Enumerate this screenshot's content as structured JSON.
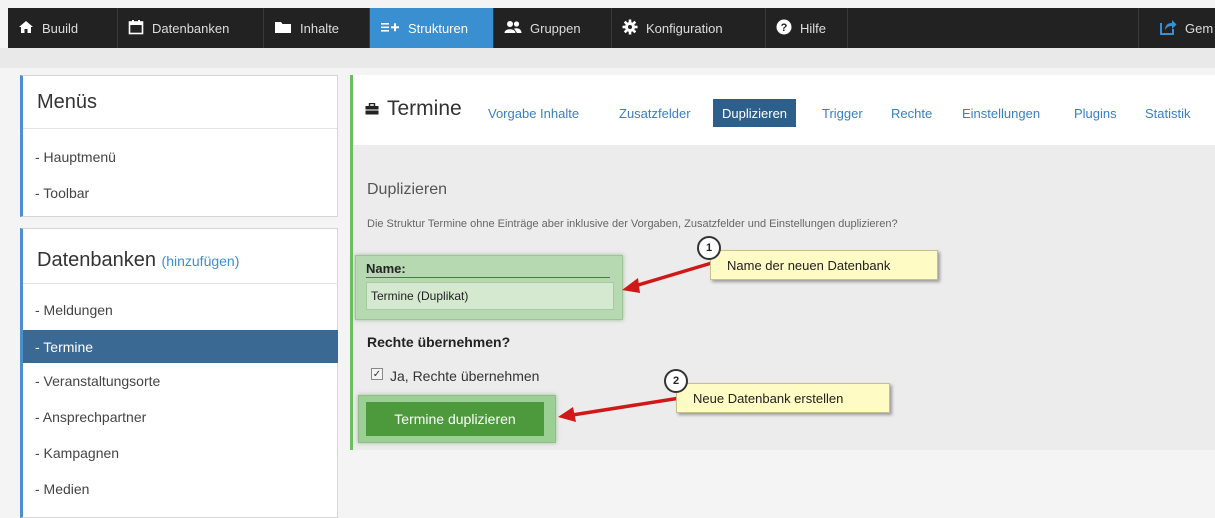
{
  "nav": {
    "items": [
      {
        "label": "Buuild",
        "icon": "home-icon"
      },
      {
        "label": "Datenbanken",
        "icon": "calendar-icon"
      },
      {
        "label": "Inhalte",
        "icon": "folder-icon"
      },
      {
        "label": "Strukturen",
        "icon": "structure-icon",
        "active": true
      },
      {
        "label": "Gruppen",
        "icon": "users-icon"
      },
      {
        "label": "Konfiguration",
        "icon": "gear-icon"
      },
      {
        "label": "Hilfe",
        "icon": "help-icon"
      }
    ],
    "right_label": "Gem",
    "right_icon": "share-icon",
    "active_color": "#3a8fd0"
  },
  "sidebar": {
    "menus": {
      "title": "Menüs",
      "items": [
        "- Hauptmenü",
        "- Toolbar"
      ]
    },
    "databases": {
      "title": "Datenbanken",
      "add_label": "(hinzufügen)",
      "items": [
        "- Meldungen",
        "- Termine",
        "- Veranstaltungsorte",
        "- Ansprechpartner",
        "- Kampagnen",
        "- Medien"
      ],
      "selected": "- Termine"
    }
  },
  "main": {
    "title": "Termine",
    "title_icon": "briefcase-icon",
    "tabs": [
      "Vorgabe Inhalte",
      "Zusatzfelder",
      "Duplizieren",
      "Trigger",
      "Rechte",
      "Einstellungen",
      "Plugins",
      "Statistik"
    ],
    "active_tab": "Duplizieren",
    "section_title": "Duplizieren",
    "section_desc": "Die Struktur Termine ohne Einträge aber inklusive der Vorgaben, Zusatzfelder und Einstellungen duplizieren?",
    "name_label": "Name:",
    "name_value": "Termine (Duplikat)",
    "rights_title": "Rechte übernehmen?",
    "rights_checkbox_label": "Ja, Rechte übernehmen",
    "rights_checked": true,
    "duplicate_button": "Termine duplizieren"
  },
  "callouts": [
    {
      "number": "1",
      "text": "Name der neuen Datenbank"
    },
    {
      "number": "2",
      "text": "Neue Datenbank erstellen"
    }
  ],
  "colors": {
    "topbar": "#222222",
    "accent": "#3a8fd0",
    "selected_item": "#3a6a93",
    "green_button": "#4d9a3c",
    "arrow": "#d01818",
    "callout_bg": "#fffbc4"
  }
}
